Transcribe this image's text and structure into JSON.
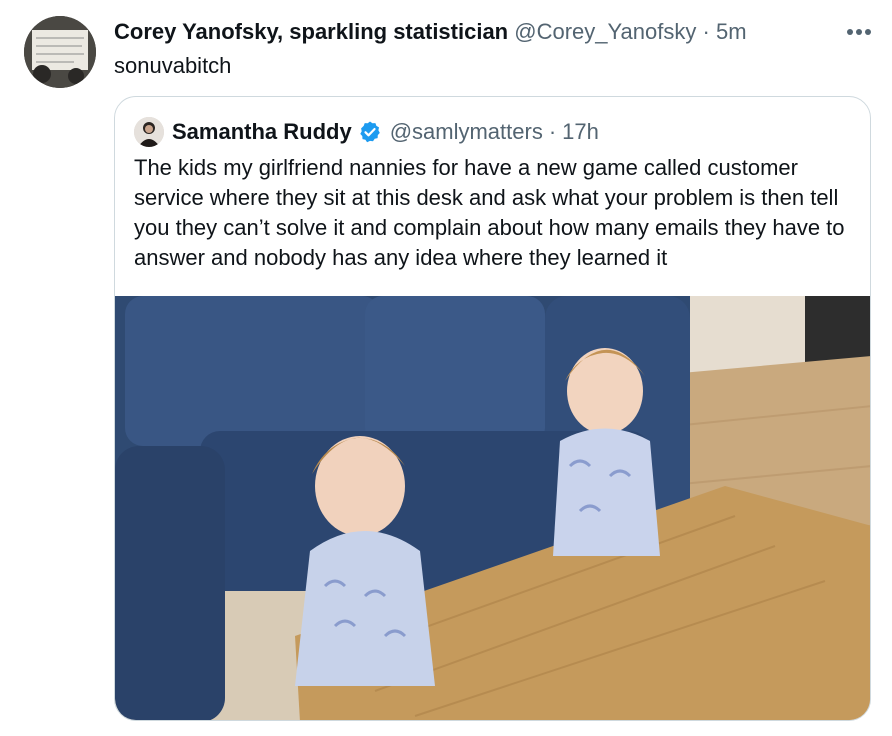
{
  "tweet": {
    "author_name": "Corey Yanofsky, sparkling statistician",
    "handle": "@Corey_Yanofsky",
    "separator": "·",
    "time": "5m",
    "text": "sonuvabitch",
    "more_icon": "more-horizontal-icon"
  },
  "quoted": {
    "author_name": "Samantha Ruddy",
    "verified_icon": "verified-badge-icon",
    "handle": "@samlymatters",
    "separator": "·",
    "time": "17h",
    "text": "The kids my girlfriend nannies for have a new game called customer service where they sit at this desk and ask what your problem is then tell you they can’t solve it and complain about how many emails they have to answer and nobody has any idea where they learned it"
  },
  "colors": {
    "text_primary": "#0f1419",
    "text_secondary": "#536471",
    "border": "#cfd9de",
    "verified_blue": "#1d9bf0"
  }
}
